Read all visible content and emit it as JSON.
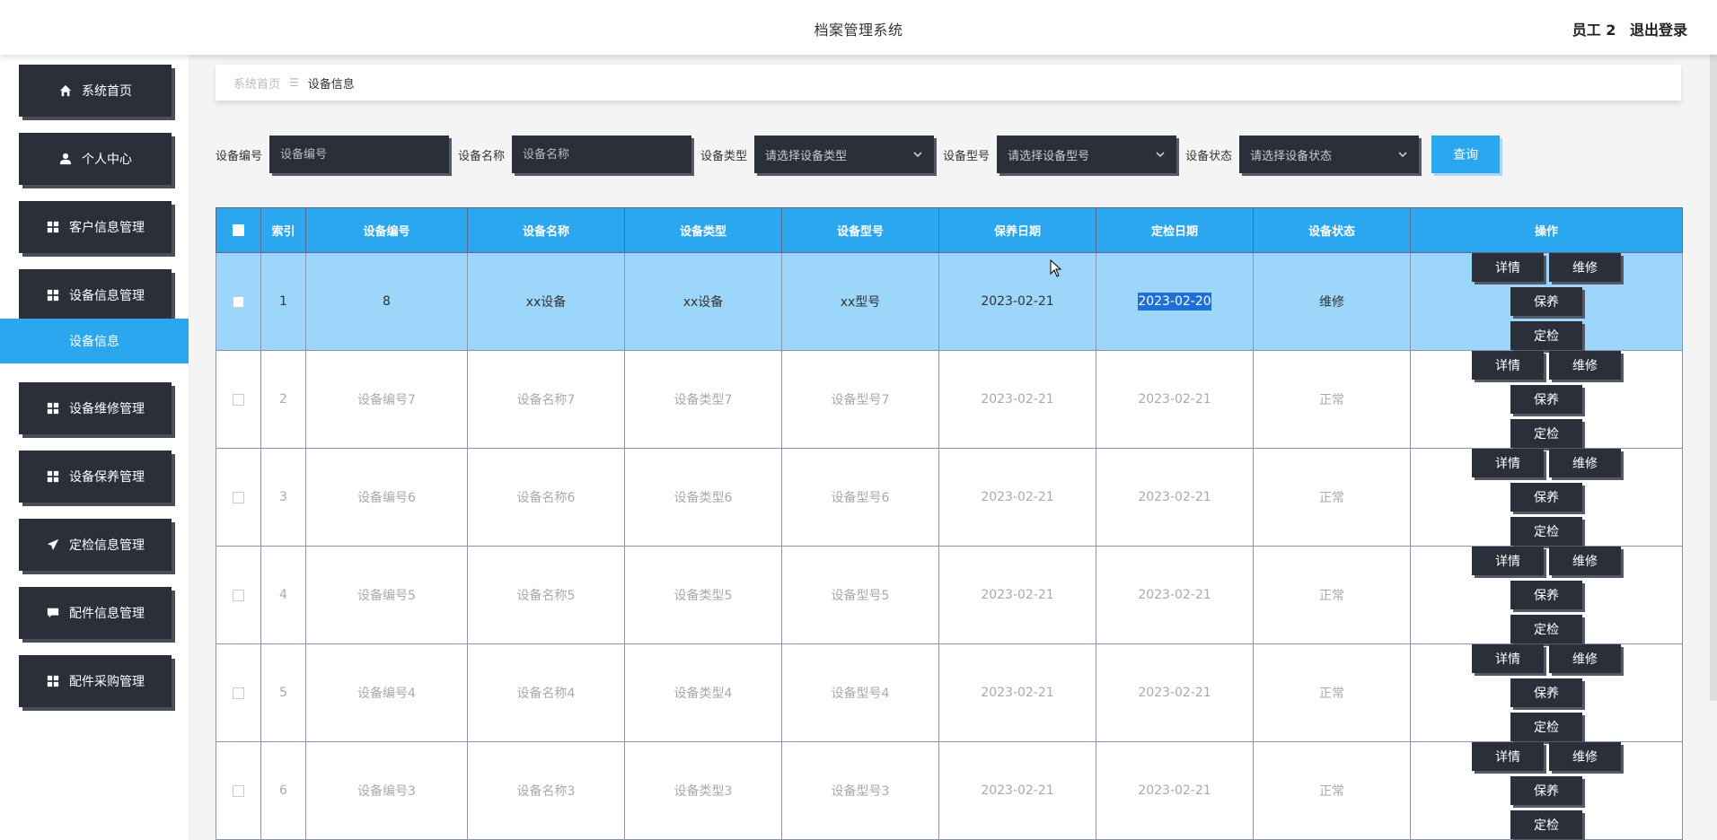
{
  "header": {
    "title": "档案管理系统",
    "user": "员工 2",
    "logout": "退出登录"
  },
  "sidebar": {
    "items": [
      {
        "label": "系统首页",
        "icon": "home-icon"
      },
      {
        "label": "个人中心",
        "icon": "user-icon"
      },
      {
        "label": "客户信息管理",
        "icon": "grid-icon"
      },
      {
        "label": "设备信息管理",
        "icon": "grid-icon"
      },
      {
        "label": "设备维修管理",
        "icon": "grid-icon"
      },
      {
        "label": "设备保养管理",
        "icon": "grid-icon"
      },
      {
        "label": "定检信息管理",
        "icon": "send-icon"
      },
      {
        "label": "配件信息管理",
        "icon": "chat-icon"
      },
      {
        "label": "配件采购管理",
        "icon": "grid-icon"
      }
    ],
    "submenu": "设备信息"
  },
  "breadcrumb": {
    "home": "系统首页",
    "current": "设备信息"
  },
  "search": {
    "fields": [
      {
        "label": "设备编号",
        "placeholder": "设备编号",
        "type": "input"
      },
      {
        "label": "设备名称",
        "placeholder": "设备名称",
        "type": "input"
      },
      {
        "label": "设备类型",
        "placeholder": "请选择设备类型",
        "type": "select"
      },
      {
        "label": "设备型号",
        "placeholder": "请选择设备型号",
        "type": "select"
      },
      {
        "label": "设备状态",
        "placeholder": "请选择设备状态",
        "type": "select"
      }
    ],
    "query_label": "查询"
  },
  "table": {
    "columns": [
      "索引",
      "设备编号",
      "设备名称",
      "设备类型",
      "设备型号",
      "保养日期",
      "定检日期",
      "设备状态",
      "操作"
    ],
    "actions": [
      "详情",
      "维修",
      "保养",
      "定检"
    ],
    "rows": [
      {
        "index": "1",
        "code": "8",
        "name": "xx设备",
        "type": "xx设备",
        "model": "xx型号",
        "maint_date": "2023-02-21",
        "inspect_date": "2023-02-20",
        "status": "维修"
      },
      {
        "index": "2",
        "code": "设备编号7",
        "name": "设备名称7",
        "type": "设备类型7",
        "model": "设备型号7",
        "maint_date": "2023-02-21",
        "inspect_date": "2023-02-21",
        "status": "正常"
      },
      {
        "index": "3",
        "code": "设备编号6",
        "name": "设备名称6",
        "type": "设备类型6",
        "model": "设备型号6",
        "maint_date": "2023-02-21",
        "inspect_date": "2023-02-21",
        "status": "正常"
      },
      {
        "index": "4",
        "code": "设备编号5",
        "name": "设备名称5",
        "type": "设备类型5",
        "model": "设备型号5",
        "maint_date": "2023-02-21",
        "inspect_date": "2023-02-21",
        "status": "正常"
      },
      {
        "index": "5",
        "code": "设备编号4",
        "name": "设备名称4",
        "type": "设备类型4",
        "model": "设备型号4",
        "maint_date": "2023-02-21",
        "inspect_date": "2023-02-21",
        "status": "正常"
      },
      {
        "index": "6",
        "code": "设备编号3",
        "name": "设备名称3",
        "type": "设备类型3",
        "model": "设备型号3",
        "maint_date": "2023-02-21",
        "inspect_date": "2023-02-21",
        "status": "正常"
      }
    ]
  },
  "colors": {
    "accent": "#2ba7f0",
    "dark_button": "#2b2f3a",
    "active_row": "#9dd6fb"
  }
}
